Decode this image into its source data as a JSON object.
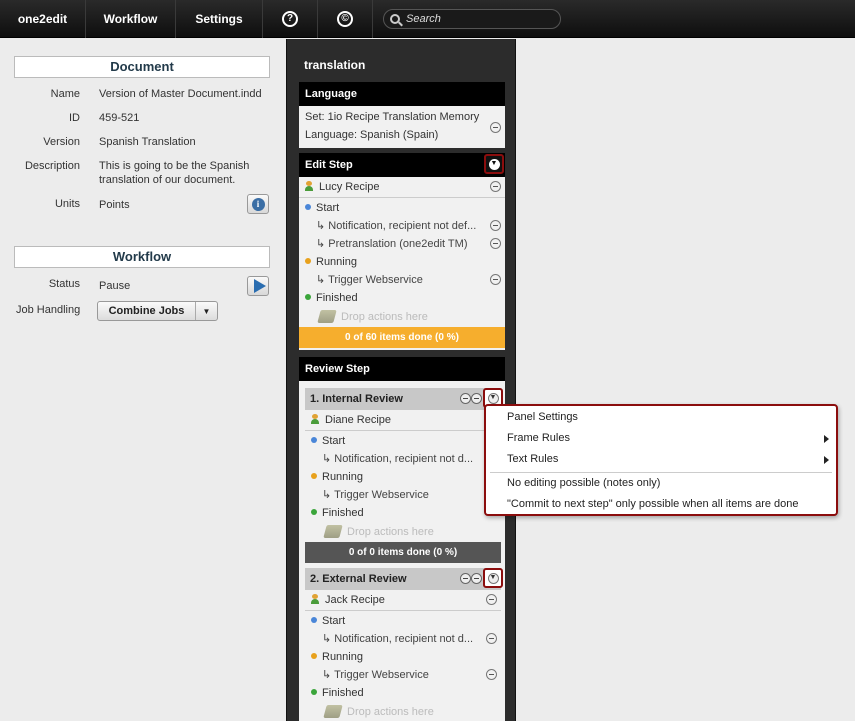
{
  "topbar": {
    "app_name": "one2edit",
    "workflow": "Workflow",
    "settings": "Settings",
    "help_glyph": "?",
    "copyright_glyph": "©",
    "search_placeholder": "Search"
  },
  "document": {
    "header": "Document",
    "props": [
      {
        "label": "Name",
        "value": "Version of Master Document.indd"
      },
      {
        "label": "ID",
        "value": "459-521"
      },
      {
        "label": "Version",
        "value": "Spanish Translation"
      },
      {
        "label": "Description",
        "value": "This is going to be the Spanish translation of our document."
      },
      {
        "label": "Units",
        "value": "Points"
      }
    ],
    "info_glyph": "i"
  },
  "workflow": {
    "header": "Workflow",
    "status_label": "Status",
    "status_value": "Pause",
    "job_label": "Job Handling",
    "job_value": "Combine Jobs",
    "caret": "▼"
  },
  "translation": {
    "title": "translation",
    "language": {
      "header": "Language",
      "set": "Set: 1io Recipe Translation Memory",
      "language": "Language: Spanish (Spain)"
    },
    "edit_step": {
      "header": "Edit Step",
      "user": "Lucy Recipe",
      "start": "Start",
      "start_actions": [
        "Notification, recipient not def...",
        "Pretranslation (one2edit TM)"
      ],
      "running": "Running",
      "running_actions": [
        "Trigger Webservice"
      ],
      "finished": "Finished",
      "drop": "Drop actions here",
      "progress": "0 of 60 items done (0 %)"
    },
    "review_step": {
      "header": "Review Step",
      "internal": {
        "title": "1. Internal Review",
        "user": "Diane Recipe",
        "start": "Start",
        "start_action": "Notification, recipient not d...",
        "running": "Running",
        "running_action": "Trigger Webservice",
        "finished": "Finished",
        "drop": "Drop actions here",
        "progress": "0 of 0 items done (0 %)"
      },
      "external": {
        "title": "2. External Review",
        "user": "Jack Recipe",
        "start": "Start",
        "start_action": "Notification, recipient not d...",
        "running": "Running",
        "running_action": "Trigger Webservice",
        "finished": "Finished",
        "drop": "Drop actions here"
      }
    },
    "dropdown_glyph": "▼"
  },
  "context_menu": {
    "items": [
      "Panel Settings",
      "Frame Rules",
      "Text Rules"
    ],
    "options": [
      "No editing possible (notes only)",
      "\"Commit to next step\" only possible when all items are done"
    ]
  },
  "colors": {
    "dot_start": "#4a86d8",
    "dot_running": "#e8a11c",
    "dot_finished": "#3aa53a",
    "progress_active": "#f6ae2d",
    "progress_inactive": "#555555",
    "highlight_border": "#8b0d0d"
  }
}
